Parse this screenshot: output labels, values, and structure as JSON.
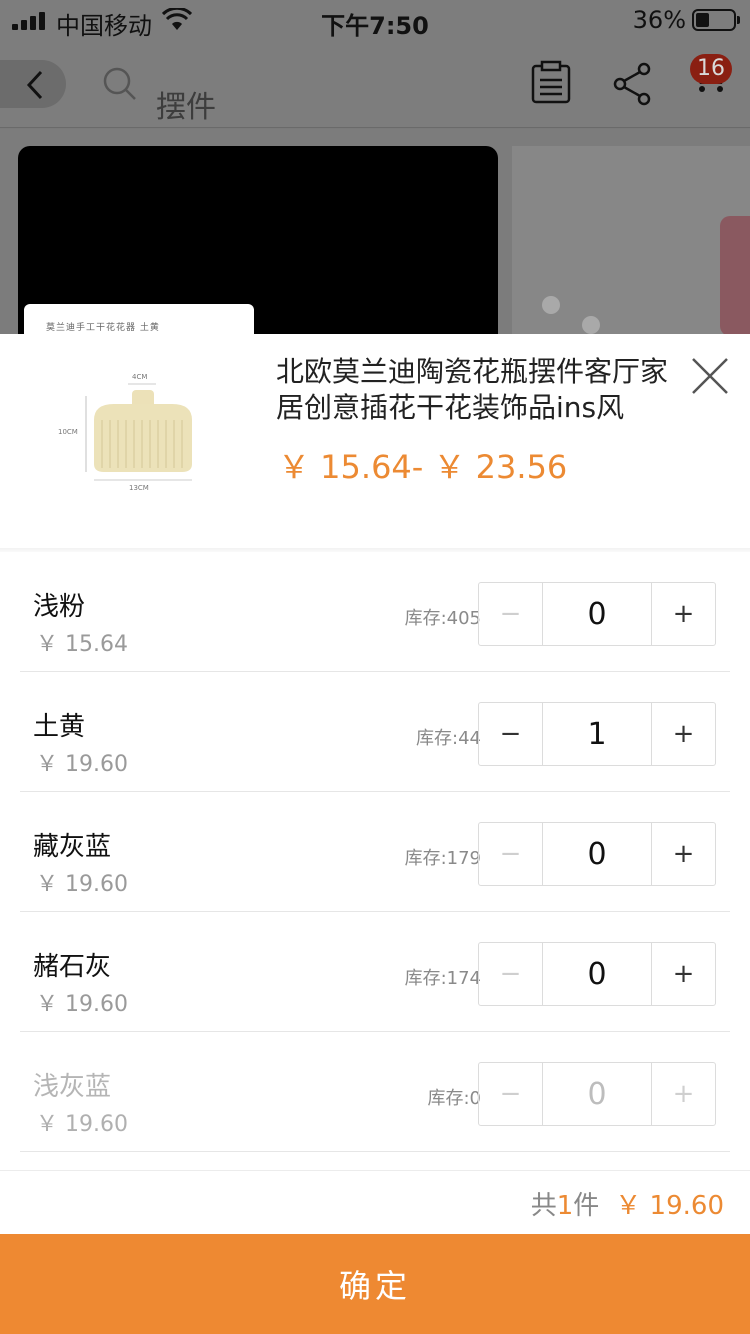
{
  "status_bar": {
    "carrier": "中国移动",
    "time": "下午7:50",
    "battery": "36%"
  },
  "nav": {
    "search_text": "摆件",
    "cart_badge": "16"
  },
  "thumb": {
    "caption": "莫兰迪手工干花花器  土黄",
    "dim_width": "4CM",
    "dim_height": "10CM",
    "dim_base": "13CM"
  },
  "product": {
    "title": "北欧莫兰迪陶瓷花瓶摆件客厅家居创意插花干花装饰品ins风",
    "price_range": "￥ 15.64- ￥ 23.56"
  },
  "variants": [
    {
      "name": "浅粉",
      "price": "￥ 15.64",
      "stock": "库存:405",
      "qty": "0",
      "minus": "−",
      "plus": "+"
    },
    {
      "name": "土黄",
      "price": "￥ 19.60",
      "stock": "库存:44",
      "qty": "1",
      "minus": "−",
      "plus": "+"
    },
    {
      "name": "藏灰蓝",
      "price": "￥ 19.60",
      "stock": "库存:179",
      "qty": "0",
      "minus": "−",
      "plus": "+"
    },
    {
      "name": "赭石灰",
      "price": "￥ 19.60",
      "stock": "库存:174",
      "qty": "0",
      "minus": "−",
      "plus": "+"
    },
    {
      "name": "浅灰蓝",
      "price": "￥ 19.60",
      "stock": "库存:0",
      "qty": "0",
      "minus": "−",
      "plus": "+"
    }
  ],
  "summary": {
    "prefix": "共",
    "count": "1",
    "suffix": "件",
    "total": "￥ 19.60"
  },
  "confirm_label": "确定",
  "colors": {
    "accent": "#ee8932",
    "price": "#ec8a33",
    "badge": "#8a1f12"
  }
}
